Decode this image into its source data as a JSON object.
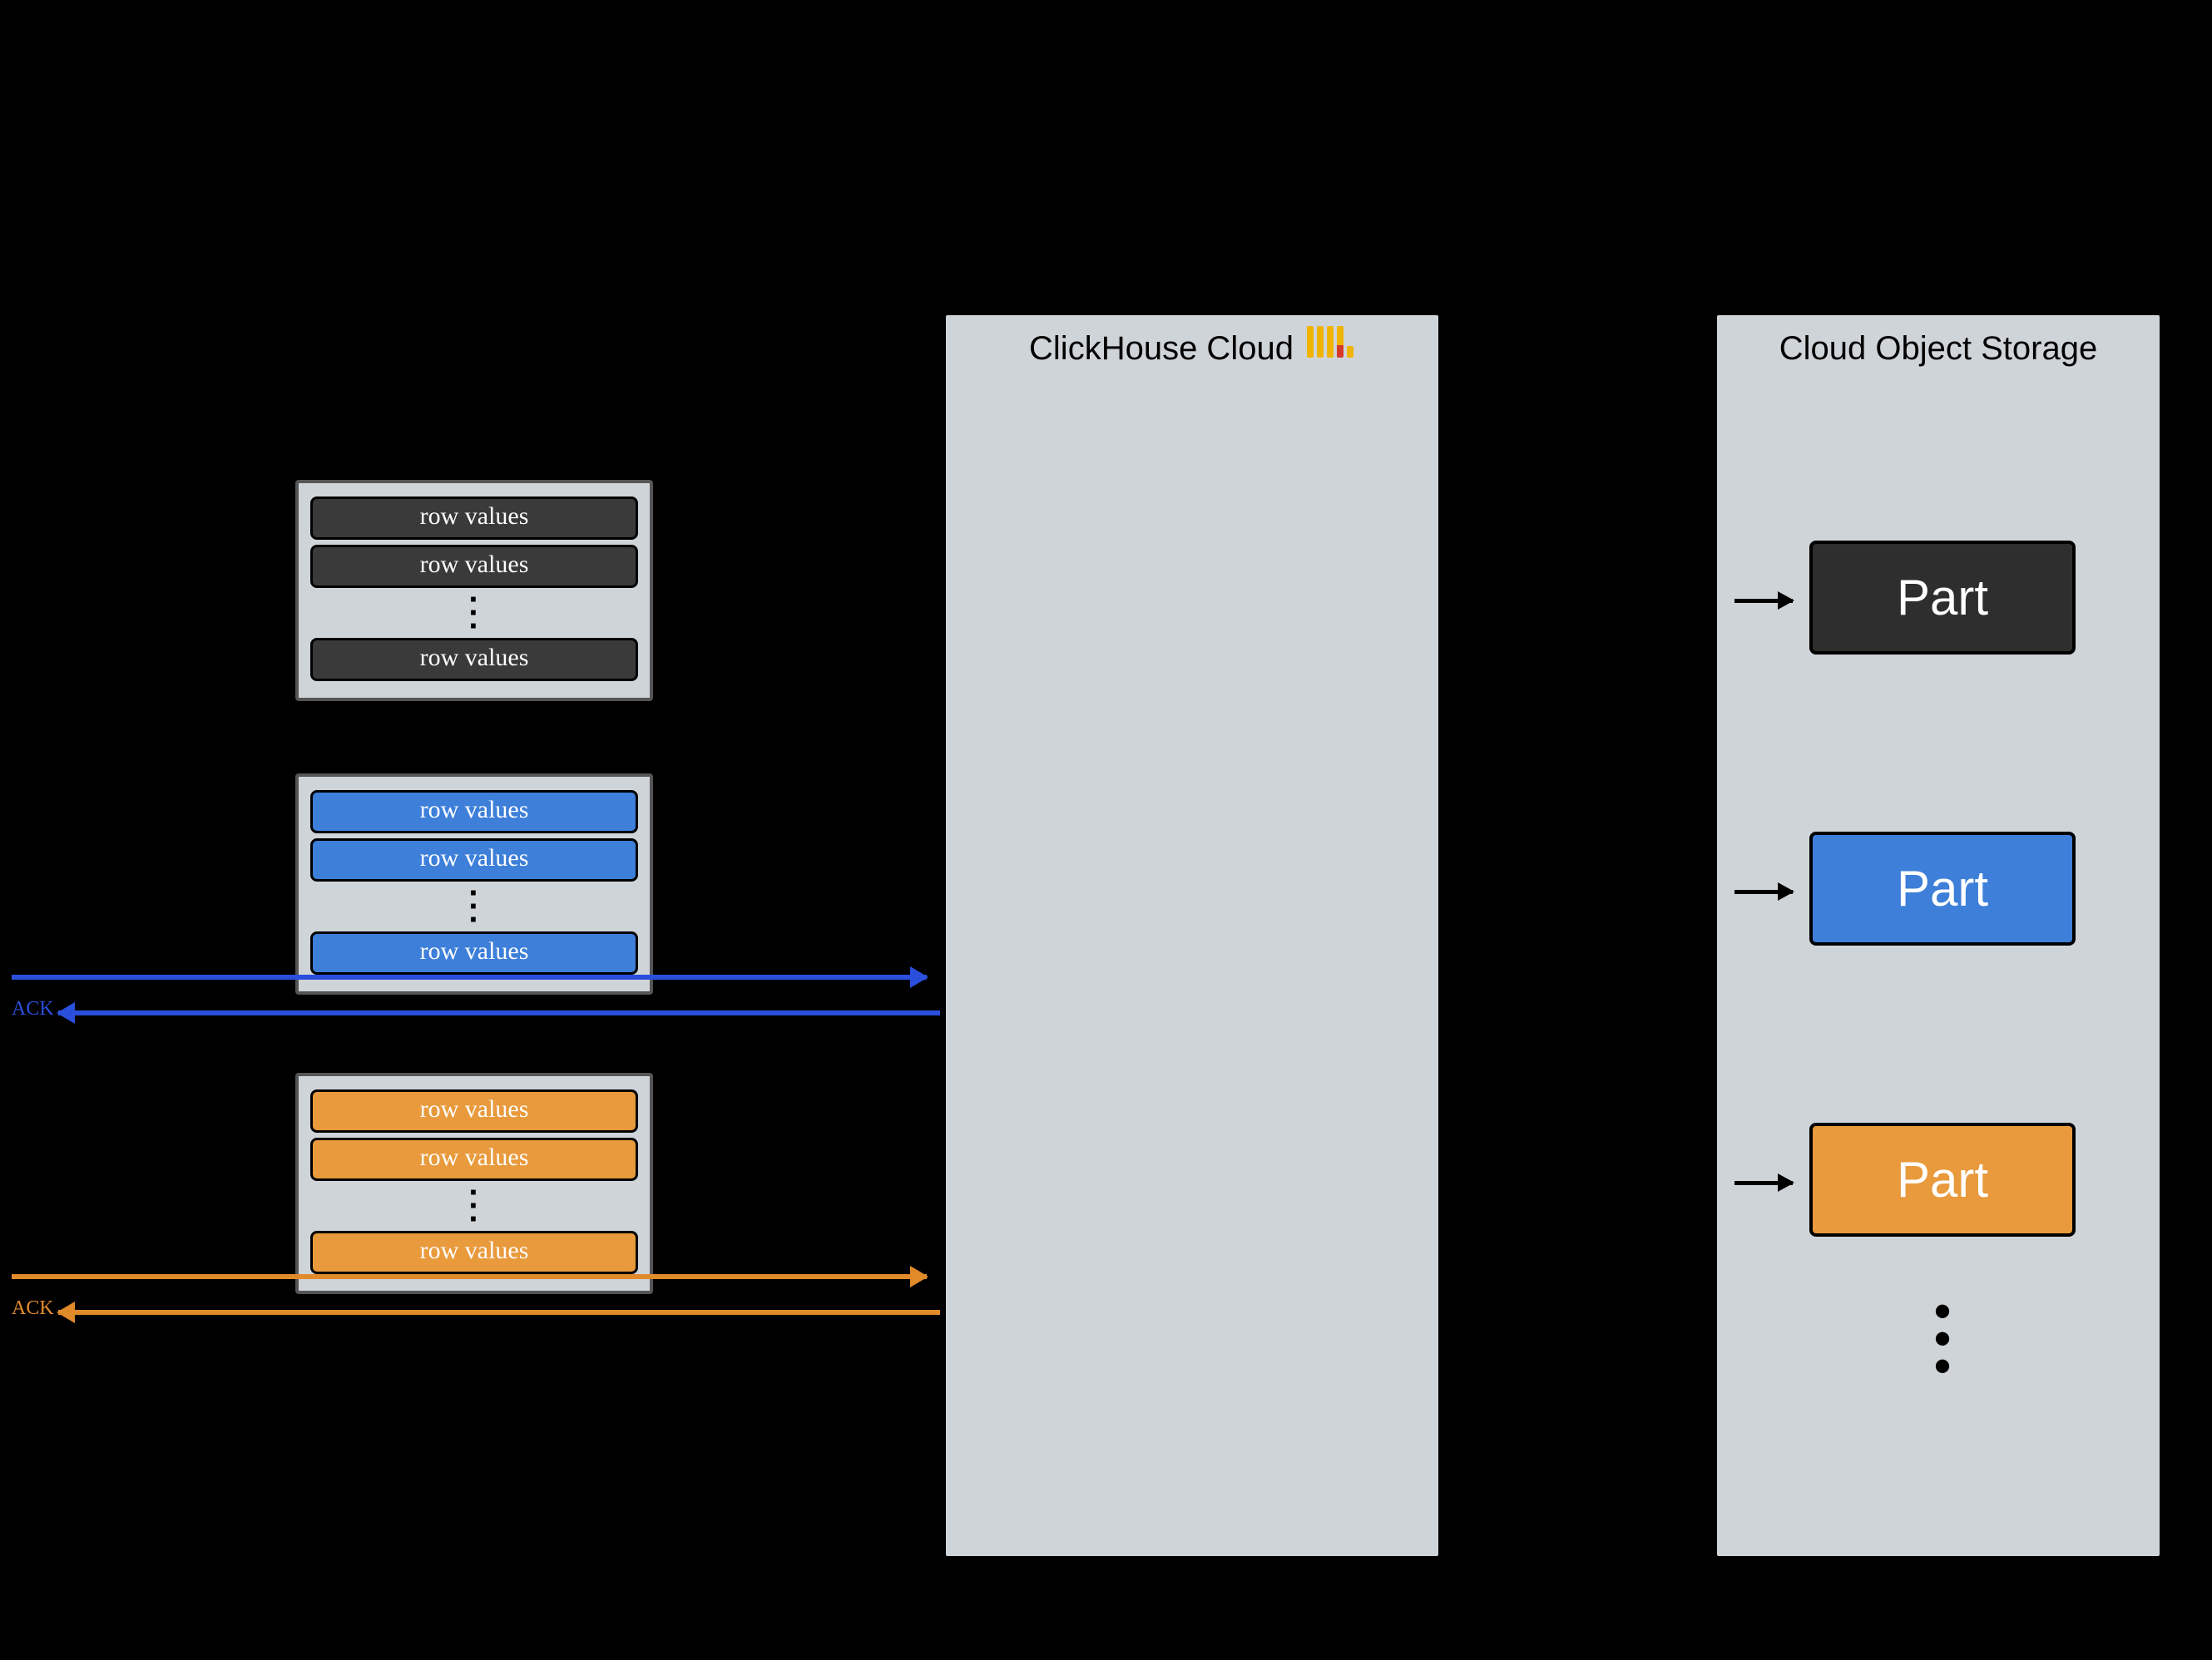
{
  "clickhouse": {
    "title": "ClickHouse Cloud"
  },
  "storage": {
    "title": "Cloud Object Storage"
  },
  "batches": {
    "dark": {
      "color_bg": "#3a3a3a",
      "rows": [
        "row values",
        "row values",
        "row values"
      ]
    },
    "blue": {
      "color_bg": "#3d7fd9",
      "ack": "ACK",
      "rows": [
        "row values",
        "row values",
        "row values"
      ]
    },
    "orange": {
      "color_bg": "#e89a3c",
      "ack": "ACK",
      "rows": [
        "row values",
        "row values",
        "row values"
      ]
    }
  },
  "parts": {
    "dark": {
      "label": "Part",
      "color": "#2e2e2e"
    },
    "blue": {
      "label": "Part",
      "color": "#3d7fd9"
    },
    "orange": {
      "label": "Part",
      "color": "#e89a3c"
    }
  },
  "colors": {
    "blue": "#2a4fdc",
    "orange": "#e08a2a",
    "panel": "#cfd4d9"
  }
}
